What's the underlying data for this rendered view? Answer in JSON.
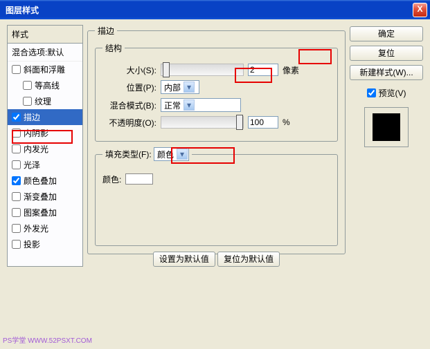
{
  "window": {
    "title": "图层样式",
    "close": "X"
  },
  "styles": {
    "header": "样式",
    "blend": "混合选项:默认",
    "items": [
      {
        "label": "斜面和浮雕",
        "checked": false
      },
      {
        "label": "等高线",
        "checked": false,
        "indent": true
      },
      {
        "label": "纹理",
        "checked": false,
        "indent": true
      },
      {
        "label": "描边",
        "checked": true,
        "selected": true
      },
      {
        "label": "内阴影",
        "checked": false
      },
      {
        "label": "内发光",
        "checked": false
      },
      {
        "label": "光泽",
        "checked": false
      },
      {
        "label": "颜色叠加",
        "checked": true
      },
      {
        "label": "渐变叠加",
        "checked": false
      },
      {
        "label": "图案叠加",
        "checked": false
      },
      {
        "label": "外发光",
        "checked": false
      },
      {
        "label": "投影",
        "checked": false
      }
    ]
  },
  "stroke": {
    "group": "描边",
    "structGroup": "结构",
    "size_label": "大小(S):",
    "size_value": "2",
    "size_unit": "像素",
    "pos_label": "位置(P):",
    "pos_value": "内部",
    "blend_label": "混合模式(B):",
    "blend_value": "正常",
    "opacity_label": "不透明度(O):",
    "opacity_value": "100",
    "opacity_unit": "%",
    "fillGroup_label": "填充类型(F):",
    "fillGroup_value": "颜色",
    "color_label": "颜色:"
  },
  "defaults": {
    "set": "设置为默认值",
    "reset": "复位为默认值"
  },
  "right": {
    "ok": "确定",
    "cancel": "复位",
    "newstyle": "新建样式(W)...",
    "preview": "预览(V)"
  },
  "watermark": "PS学堂  WWW.52PSXT.COM"
}
